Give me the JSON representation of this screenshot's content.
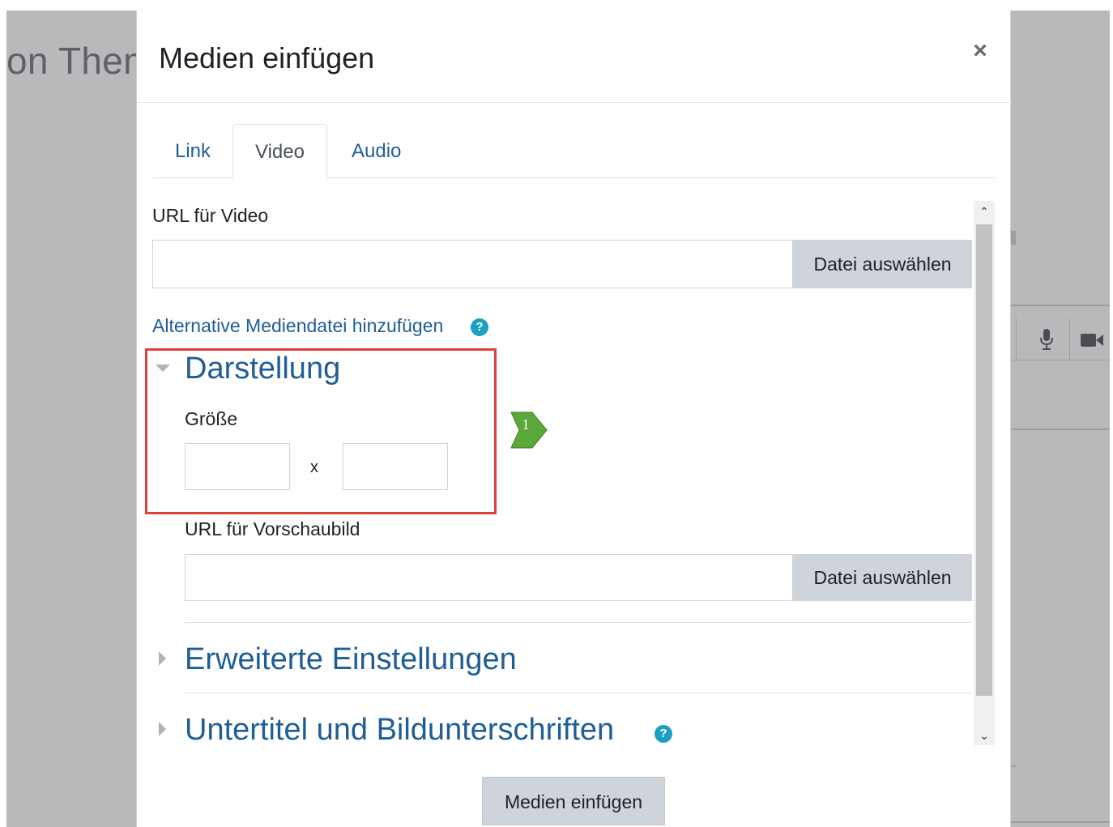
{
  "background": {
    "page_title_fragment": "on Them"
  },
  "modal": {
    "title": "Medien einfügen",
    "close_glyph": "×",
    "tabs": [
      {
        "label": "Link",
        "active": false
      },
      {
        "label": "Video",
        "active": true
      },
      {
        "label": "Audio",
        "active": false
      }
    ],
    "video_url": {
      "label": "URL für Video",
      "value": "",
      "browse_label": "Datei auswählen"
    },
    "alternative_link": "Alternative Mediendatei hinzufügen",
    "help_glyph": "?",
    "display_section": {
      "title": "Darstellung",
      "expanded": true,
      "size_label": "Größe",
      "width_value": "",
      "height_value": "",
      "separator": "x",
      "poster_label": "URL für Vorschaubild",
      "poster_value": "",
      "poster_browse_label": "Datei auswählen"
    },
    "advanced_section": {
      "title": "Erweiterte Einstellungen",
      "expanded": false
    },
    "subtitles_section": {
      "title": "Untertitel und Bildunterschriften",
      "expanded": false
    },
    "submit_label": "Medien einfügen"
  },
  "annotation": {
    "callout_number": "1",
    "highlight_color": "#e0403c",
    "callout_color": "#5aa83a"
  },
  "colors": {
    "link": "#1f5e95",
    "button_bg": "#ced4da",
    "backdrop": "#b8b9bb",
    "help_icon": "#1aa0c0"
  },
  "icons": {
    "close": "close-icon",
    "help": "question-circle-icon",
    "expanded": "caret-down-icon",
    "collapsed": "caret-right-icon",
    "mic": "microphone-icon",
    "camera": "video-camera-icon"
  }
}
